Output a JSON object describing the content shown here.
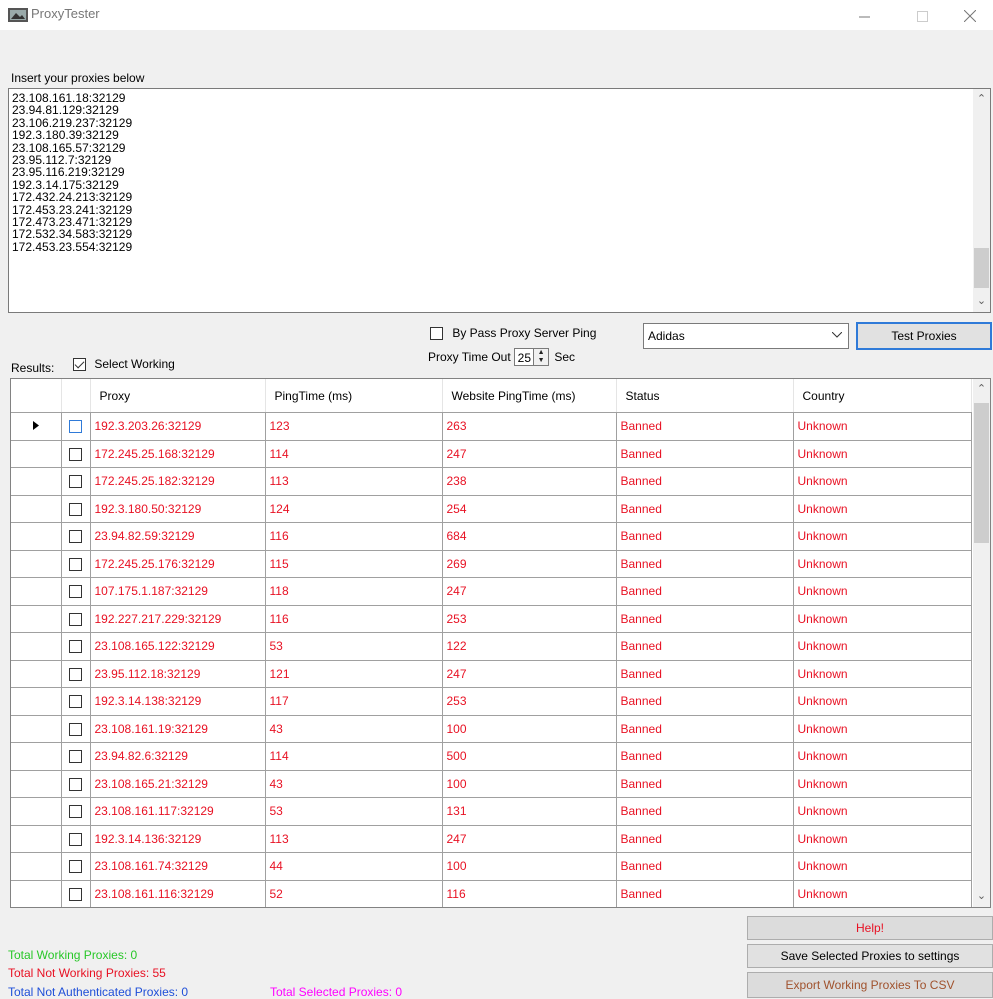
{
  "window": {
    "title": "ProxyTester"
  },
  "proxy_input": {
    "label": "Insert your proxies below",
    "lines": "23.108.161.18:32129\n23.94.81.129:32129\n23.106.219.237:32129\n192.3.180.39:32129\n23.108.165.57:32129\n23.95.112.7:32129\n23.95.116.219:32129\n192.3.14.175:32129\n172.432.24.213:32129\n172.453.23.241:32129\n172.473.23.471:32129\n172.532.34.583:32129\n172.453.23.554:32129"
  },
  "options": {
    "bypass_label": "By Pass Proxy Server Ping",
    "bypass_checked": false,
    "timeout_label": "Proxy Time Out",
    "timeout_value": "25",
    "timeout_unit": "Sec",
    "site_selected": "Adidas",
    "test_button": "Test Proxies"
  },
  "results": {
    "label": "Results:",
    "select_working_label": "Select Working",
    "select_working_checked": true
  },
  "grid": {
    "columns": [
      "Proxy",
      "PingTime (ms)",
      "Website PingTime (ms)",
      "Status",
      "Country"
    ],
    "rows": [
      [
        "192.3.203.26:32129",
        "123",
        "263",
        "Banned",
        "Unknown"
      ],
      [
        "172.245.25.168:32129",
        "114",
        "247",
        "Banned",
        "Unknown"
      ],
      [
        "172.245.25.182:32129",
        "113",
        "238",
        "Banned",
        "Unknown"
      ],
      [
        "192.3.180.50:32129",
        "124",
        "254",
        "Banned",
        "Unknown"
      ],
      [
        "23.94.82.59:32129",
        "116",
        "684",
        "Banned",
        "Unknown"
      ],
      [
        "172.245.25.176:32129",
        "115",
        "269",
        "Banned",
        "Unknown"
      ],
      [
        "107.175.1.187:32129",
        "118",
        "247",
        "Banned",
        "Unknown"
      ],
      [
        "192.227.217.229:32129",
        "116",
        "253",
        "Banned",
        "Unknown"
      ],
      [
        "23.108.165.122:32129",
        "53",
        "122",
        "Banned",
        "Unknown"
      ],
      [
        "23.95.112.18:32129",
        "121",
        "247",
        "Banned",
        "Unknown"
      ],
      [
        "192.3.14.138:32129",
        "117",
        "253",
        "Banned",
        "Unknown"
      ],
      [
        "23.108.161.19:32129",
        "43",
        "100",
        "Banned",
        "Unknown"
      ],
      [
        "23.94.82.6:32129",
        "114",
        "500",
        "Banned",
        "Unknown"
      ],
      [
        "23.108.165.21:32129",
        "43",
        "100",
        "Banned",
        "Unknown"
      ],
      [
        "23.108.161.117:32129",
        "53",
        "131",
        "Banned",
        "Unknown"
      ],
      [
        "192.3.14.136:32129",
        "113",
        "247",
        "Banned",
        "Unknown"
      ],
      [
        "23.108.161.74:32129",
        "44",
        "100",
        "Banned",
        "Unknown"
      ],
      [
        "23.108.161.116:32129",
        "52",
        "116",
        "Banned",
        "Unknown"
      ]
    ]
  },
  "buttons": {
    "help": "Help!",
    "save": "Save Selected Proxies to settings",
    "export": "Export Working Proxies To CSV"
  },
  "stats": {
    "working": "Total Working Proxies: 0",
    "not_working": "Total Not Working Proxies: 55",
    "not_authenticated": "Total Not Authenticated Proxies: 0",
    "selected": "Total Selected Proxies: 0"
  },
  "colors": {
    "row_text": "#e81123",
    "working": "#28c728",
    "not_working": "#e81123",
    "not_authenticated": "#1f4fd8",
    "selected": "#ff00ff",
    "accent": "#2f7ad8"
  }
}
